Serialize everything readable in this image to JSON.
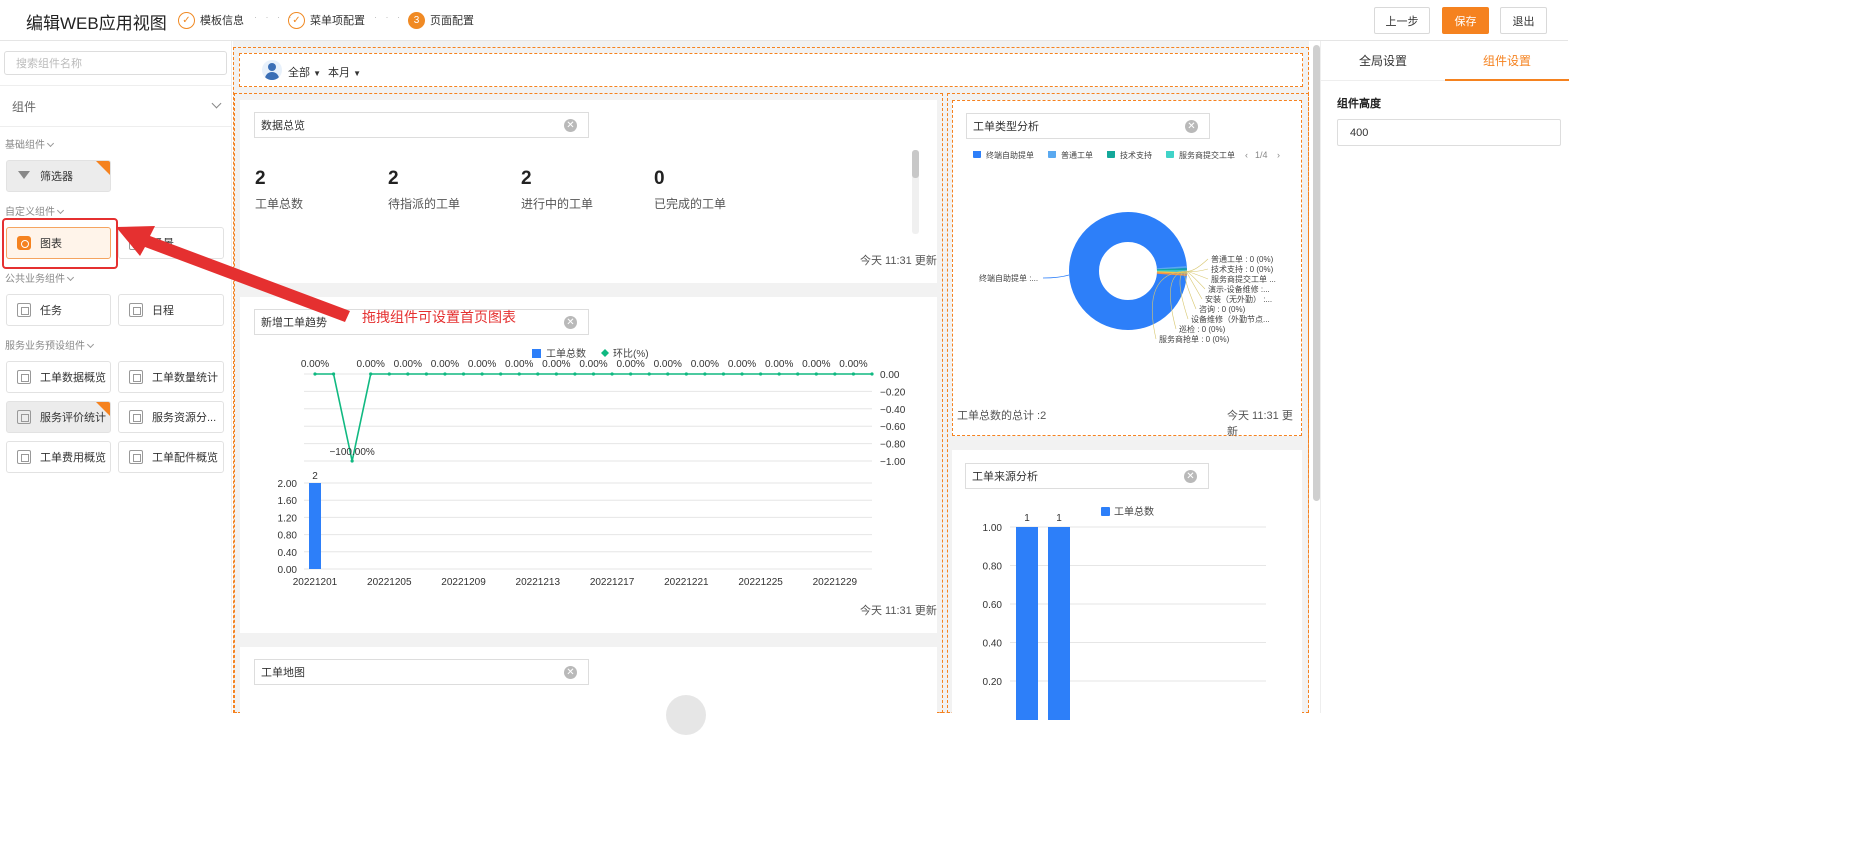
{
  "header": {
    "title": "编辑WEB应用视图",
    "steps": [
      {
        "index": "1",
        "label": "模板信息",
        "state": "done"
      },
      {
        "index": "2",
        "label": "菜单项配置",
        "state": "done"
      },
      {
        "index": "3",
        "label": "页面配置",
        "state": "current"
      }
    ],
    "step_dots": "· · · ·",
    "prev_label": "上一步",
    "save_label": "保存",
    "exit_label": "退出"
  },
  "sidebar": {
    "search_placeholder": "搜索组件名称",
    "component_select": "组件",
    "groups": [
      {
        "title": "基础组件",
        "items": [
          {
            "label": "筛选器",
            "icon": "filter-icon"
          }
        ]
      },
      {
        "title": "自定义组件",
        "items": [
          {
            "label": "图表",
            "icon": "chart-icon"
          },
          {
            "label": "场景",
            "icon": "scene-icon"
          }
        ]
      },
      {
        "title": "公共业务组件",
        "items": [
          {
            "label": "任务",
            "icon": "task-icon"
          },
          {
            "label": "日程",
            "icon": "schedule-icon"
          }
        ]
      },
      {
        "title": "服务业务预设组件",
        "items": [
          {
            "label": "工单数据概览",
            "icon": "widget-icon"
          },
          {
            "label": "工单数量统计",
            "icon": "widget-icon"
          },
          {
            "label": "服务评价统计",
            "icon": "widget-icon"
          },
          {
            "label": "服务资源分...",
            "icon": "widget-icon"
          },
          {
            "label": "工单费用概览",
            "icon": "widget-icon"
          },
          {
            "label": "工单配件概览",
            "icon": "widget-icon"
          }
        ]
      }
    ]
  },
  "filterbar": {
    "scope": "全部",
    "period": "本月"
  },
  "annotation": {
    "text": "拖拽组件可设置首页图表"
  },
  "overview": {
    "title": "数据总览",
    "stats": [
      {
        "value": "2",
        "label": "工单总数"
      },
      {
        "value": "2",
        "label": "待指派的工单"
      },
      {
        "value": "2",
        "label": "进行中的工单"
      },
      {
        "value": "0",
        "label": "已完成的工单"
      }
    ],
    "updated": "今天 11:31 更新"
  },
  "trend": {
    "title": "新增工单趋势",
    "updated": "今天 11:31 更新"
  },
  "map": {
    "title": "工单地图"
  },
  "type_analysis": {
    "title": "工单类型分析",
    "total": "工单总数的总计 :2",
    "updated": "今天 11:31 更新"
  },
  "source_analysis": {
    "title": "工单来源分析"
  },
  "rpanel": {
    "tab_global": "全局设置",
    "tab_component": "组件设置",
    "field_label": "组件高度",
    "field_value": "400"
  },
  "colors": {
    "accent": "#f5821f",
    "bar": "#2d7ff9",
    "line": "#10b981",
    "annotation": "#e53030"
  },
  "chart_data": [
    {
      "type": "bar+line",
      "title": "新增工单趋势",
      "x_ticks": [
        "20221201",
        "20221205",
        "20221209",
        "20221213",
        "20221217",
        "20221221",
        "20221225",
        "20221229"
      ],
      "series": [
        {
          "name": "工单总数",
          "type": "bar",
          "axis": "left",
          "values": [
            2,
            0,
            0,
            0,
            0,
            0,
            0,
            0,
            0,
            0,
            0,
            0,
            0,
            0,
            0,
            0,
            0,
            0,
            0,
            0,
            0,
            0,
            0,
            0,
            0,
            0,
            0,
            0,
            0,
            0,
            0
          ]
        },
        {
          "name": "环比(%)",
          "type": "line",
          "axis": "right",
          "values": [
            0,
            0,
            -100,
            0,
            0,
            0,
            0,
            0,
            0,
            0,
            0,
            0,
            0,
            0,
            0,
            0,
            0,
            0,
            0,
            0,
            0,
            0,
            0,
            0,
            0,
            0,
            0,
            0,
            0,
            0,
            0
          ]
        }
      ],
      "bar_labels": [
        "2"
      ],
      "line_labels": [
        "0.00%",
        "−100.00%",
        "0.00%",
        "0.00%",
        "0.00%",
        "0.00%",
        "0.00%",
        "0.00%",
        "0.00%",
        "0.00%",
        "0.00%",
        "0.00%",
        "0.00%",
        "0.00%",
        "0.00%",
        "0.00%"
      ],
      "ylim_left": [
        0,
        2
      ],
      "yticks_left": [
        "2.00",
        "1.60",
        "1.20",
        "0.80",
        "0.40",
        "0.00"
      ],
      "ylim_right": [
        -1,
        0
      ],
      "yticks_right": [
        "0.00",
        "−0.20",
        "−0.40",
        "−0.60",
        "−0.80",
        "−1.00"
      ],
      "legend": "top"
    },
    {
      "type": "pie",
      "title": "工单类型分析",
      "legend": [
        {
          "name": "终端自助提单",
          "color": "#2d7ff9"
        },
        {
          "name": "普通工单",
          "color": "#5aa9f0"
        },
        {
          "name": "技术支持",
          "color": "#14a89a"
        },
        {
          "name": "服务商提交工单",
          "color": "#40d3c8"
        }
      ],
      "legend_page": "1/4",
      "slices": [
        {
          "name": "终端自助提单",
          "value": 2,
          "label": "终端自助提单 :..."
        },
        {
          "name": "普通工单",
          "value": 0,
          "label": "普通工单 : 0 (0%)"
        },
        {
          "name": "技术支持",
          "value": 0,
          "label": "技术支持 : 0 (0%)"
        },
        {
          "name": "服务商提交工单",
          "value": 0,
          "label": "服务商提交工单 ..."
        },
        {
          "name": "演示-设备维修",
          "value": 0,
          "label": "演示-设备维修 :..."
        },
        {
          "name": "安装（无外勤）",
          "value": 0,
          "label": "安装（无外勤） :..."
        },
        {
          "name": "咨询",
          "value": 0,
          "label": "咨询 : 0 (0%)"
        },
        {
          "name": "设备维修（外勤节点...",
          "value": 0,
          "label": "设备维修（外勤节点..."
        },
        {
          "name": "巡检",
          "value": 0,
          "label": "巡检 : 0 (0%)"
        },
        {
          "name": "服务商抢单",
          "value": 0,
          "label": "服务商抢单 : 0 (0%)"
        }
      ]
    },
    {
      "type": "bar",
      "title": "工单来源分析",
      "legend": [
        "工单总数"
      ],
      "values": [
        1,
        1
      ],
      "value_labels": [
        "1",
        "1"
      ],
      "ylim": [
        0,
        1
      ],
      "yticks": [
        "1.00",
        "0.80",
        "0.60",
        "0.40",
        "0.20"
      ]
    }
  ]
}
